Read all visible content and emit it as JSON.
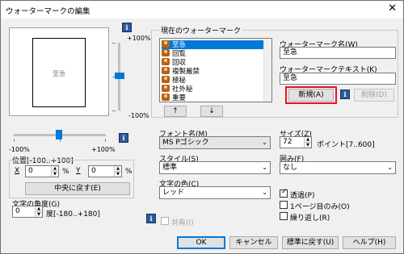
{
  "window": {
    "title": "ウォーターマークの編集",
    "close": "✕"
  },
  "preview": {
    "watermark_text": "至急"
  },
  "vertical_slider": {
    "max_label": "+100%",
    "min_label": "-100%"
  },
  "horizontal_slider": {
    "min_label": "-100%",
    "max_label": "+100%"
  },
  "position": {
    "label": "位置[-100..+100]",
    "x_label": "X",
    "x_value": "0",
    "x_unit": "%",
    "y_label": "Y",
    "y_value": "0",
    "y_unit": "%",
    "center_button": "中央に戻す(E)"
  },
  "angle": {
    "label": "文字の角度(G)",
    "value": "0",
    "range": "度[-180..+180]"
  },
  "shared": {
    "label": "共有(I)",
    "checked": false
  },
  "current_group": {
    "label": "現在のウォーターマーク",
    "items": [
      "至急",
      "回覧",
      "回収",
      "複製厳禁",
      "極秘",
      "社外秘",
      "重要"
    ],
    "selected_index": 0,
    "up_button": "↑",
    "down_button": "↓"
  },
  "name_field": {
    "label": "ウォーターマーク名(W)",
    "value": "至急"
  },
  "text_field": {
    "label": "ウォーターマークテキスト(K)",
    "value": "至急"
  },
  "new_button": "新規(A)",
  "delete_button": "削除(D)",
  "font": {
    "label": "フォント名(M)",
    "value": "MS Pゴシック"
  },
  "size": {
    "label": "サイズ(Z)",
    "value": "72",
    "range": "ポイント[7..600]"
  },
  "style": {
    "label": "スタイル(S)",
    "value": "標準"
  },
  "frame": {
    "label": "囲み(F)",
    "value": "なし"
  },
  "color": {
    "label": "文字の色(C)",
    "value": "レッド"
  },
  "options": {
    "transparent": {
      "label": "透過(P)",
      "checked": true
    },
    "first_page": {
      "label": "1ページ目のみ(O)",
      "checked": false
    },
    "repeat": {
      "label": "繰り返し(R)",
      "checked": false
    }
  },
  "footer": {
    "ok": "OK",
    "cancel": "キャンセル",
    "default": "標準に戻す(U)",
    "help": "ヘルプ(H)"
  },
  "colors": {
    "accent": "#0078d7",
    "highlight": "#e81123",
    "info_icon": "#2c5aa0"
  }
}
